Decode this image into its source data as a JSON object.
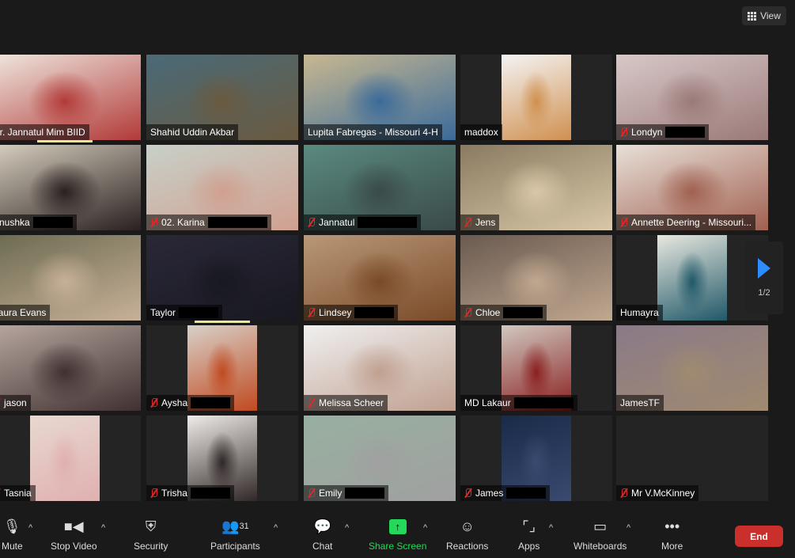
{
  "view_button": {
    "label": "View",
    "icon": "grid-icon"
  },
  "pagination": {
    "label": "1/2",
    "icon": "next-page-arrow-icon"
  },
  "tiles": [
    {
      "name": "Dr. Jannatul Mim BIID",
      "muted": false,
      "redacted": false,
      "colors": [
        "#efe8e0",
        "#b23a38"
      ],
      "audio": true
    },
    {
      "name": "Shahid Uddin Akbar",
      "muted": false,
      "redacted": false,
      "colors": [
        "#4a6a78",
        "#6a5a40"
      ]
    },
    {
      "name": "Lupita Fabregas - Missouri 4-H",
      "muted": false,
      "redacted": false,
      "colors": [
        "#c8b890",
        "#3a6a9a"
      ]
    },
    {
      "name": "maddox",
      "muted": false,
      "redacted": false,
      "inset": true,
      "colors": [
        "#f4f4f4",
        "#d09050"
      ]
    },
    {
      "name": "Londyn",
      "muted": true,
      "redacted": true,
      "colors": [
        "#d8c8c8",
        "#9a7a78"
      ]
    },
    {
      "name": "Anushka",
      "muted": false,
      "redacted": true,
      "colors": [
        "#d8d0c0",
        "#2a2020"
      ]
    },
    {
      "name": "02. Karina",
      "muted": true,
      "redacted": true,
      "colors": [
        "#c8d0c8",
        "#d0a090"
      ]
    },
    {
      "name": "Jannatul",
      "muted": true,
      "redacted": true,
      "colors": [
        "#5a8a80",
        "#3a4a48"
      ]
    },
    {
      "name": "Jens",
      "muted": true,
      "redacted": false,
      "colors": [
        "#8a7a60",
        "#d8c8a8"
      ]
    },
    {
      "name": "Annette Deering - Missouri...",
      "muted": true,
      "redacted": false,
      "colors": [
        "#e8e0d8",
        "#a06050"
      ]
    },
    {
      "name": "Laura Evans",
      "muted": false,
      "redacted": false,
      "colors": [
        "#6a6a50",
        "#c8b098"
      ]
    },
    {
      "name": "Taylor",
      "muted": false,
      "redacted": true,
      "colors": [
        "#2a2838",
        "#181820"
      ],
      "audio": true
    },
    {
      "name": "Lindsey",
      "muted": true,
      "redacted": true,
      "colors": [
        "#b89878",
        "#7a4a28"
      ]
    },
    {
      "name": "Chloe",
      "muted": true,
      "redacted": true,
      "colors": [
        "#6a5a50",
        "#c0a890"
      ]
    },
    {
      "name": "Humayra",
      "muted": false,
      "redacted": false,
      "inset": true,
      "colors": [
        "#e8e8e0",
        "#205868"
      ]
    },
    {
      "name": "jason",
      "muted": true,
      "redacted": false,
      "colors": [
        "#b8a8a0",
        "#403030"
      ]
    },
    {
      "name": "Aysha",
      "muted": true,
      "redacted": true,
      "inset": true,
      "colors": [
        "#d8d0c8",
        "#c04a20"
      ]
    },
    {
      "name": "Melissa Scheer",
      "muted": true,
      "redacted": false,
      "colors": [
        "#f0f0f0",
        "#c0a090"
      ]
    },
    {
      "name": "MD Lakaur",
      "muted": false,
      "redacted": true,
      "inset": true,
      "colors": [
        "#d0c8c0",
        "#8a2020"
      ]
    },
    {
      "name": "JamesTF",
      "muted": false,
      "redacted": false,
      "speaking": true,
      "colors": [
        "#8a7a88",
        "#a08a70"
      ]
    },
    {
      "name": "Tasnia",
      "muted": true,
      "redacted": false,
      "inset": true,
      "colors": [
        "#e8d8d0",
        "#e0b0b0"
      ]
    },
    {
      "name": "Trisha",
      "muted": true,
      "redacted": true,
      "inset": true,
      "colors": [
        "#f0ece8",
        "#302828"
      ]
    },
    {
      "name": "Emily",
      "muted": true,
      "redacted": true,
      "colors": [
        "#98b0a0",
        "#a0a0a0"
      ]
    },
    {
      "name": "James",
      "muted": true,
      "redacted": true,
      "inset": true,
      "colors": [
        "#1a2a48",
        "#3a4a70"
      ]
    },
    {
      "name": "Mr V.McKinney",
      "muted": true,
      "redacted": false,
      "colors": [
        "#242424",
        "#242424"
      ]
    }
  ],
  "toolbar": {
    "mute": "Mute",
    "video": "Stop Video",
    "security": "Security",
    "participants": "Participants",
    "participants_count": "31",
    "chat": "Chat",
    "share": "Share Screen",
    "reactions": "Reactions",
    "apps": "Apps",
    "whiteboards": "Whiteboards",
    "more": "More",
    "end": "End",
    "accent_green": "#23d959",
    "end_color": "#c9302c"
  }
}
